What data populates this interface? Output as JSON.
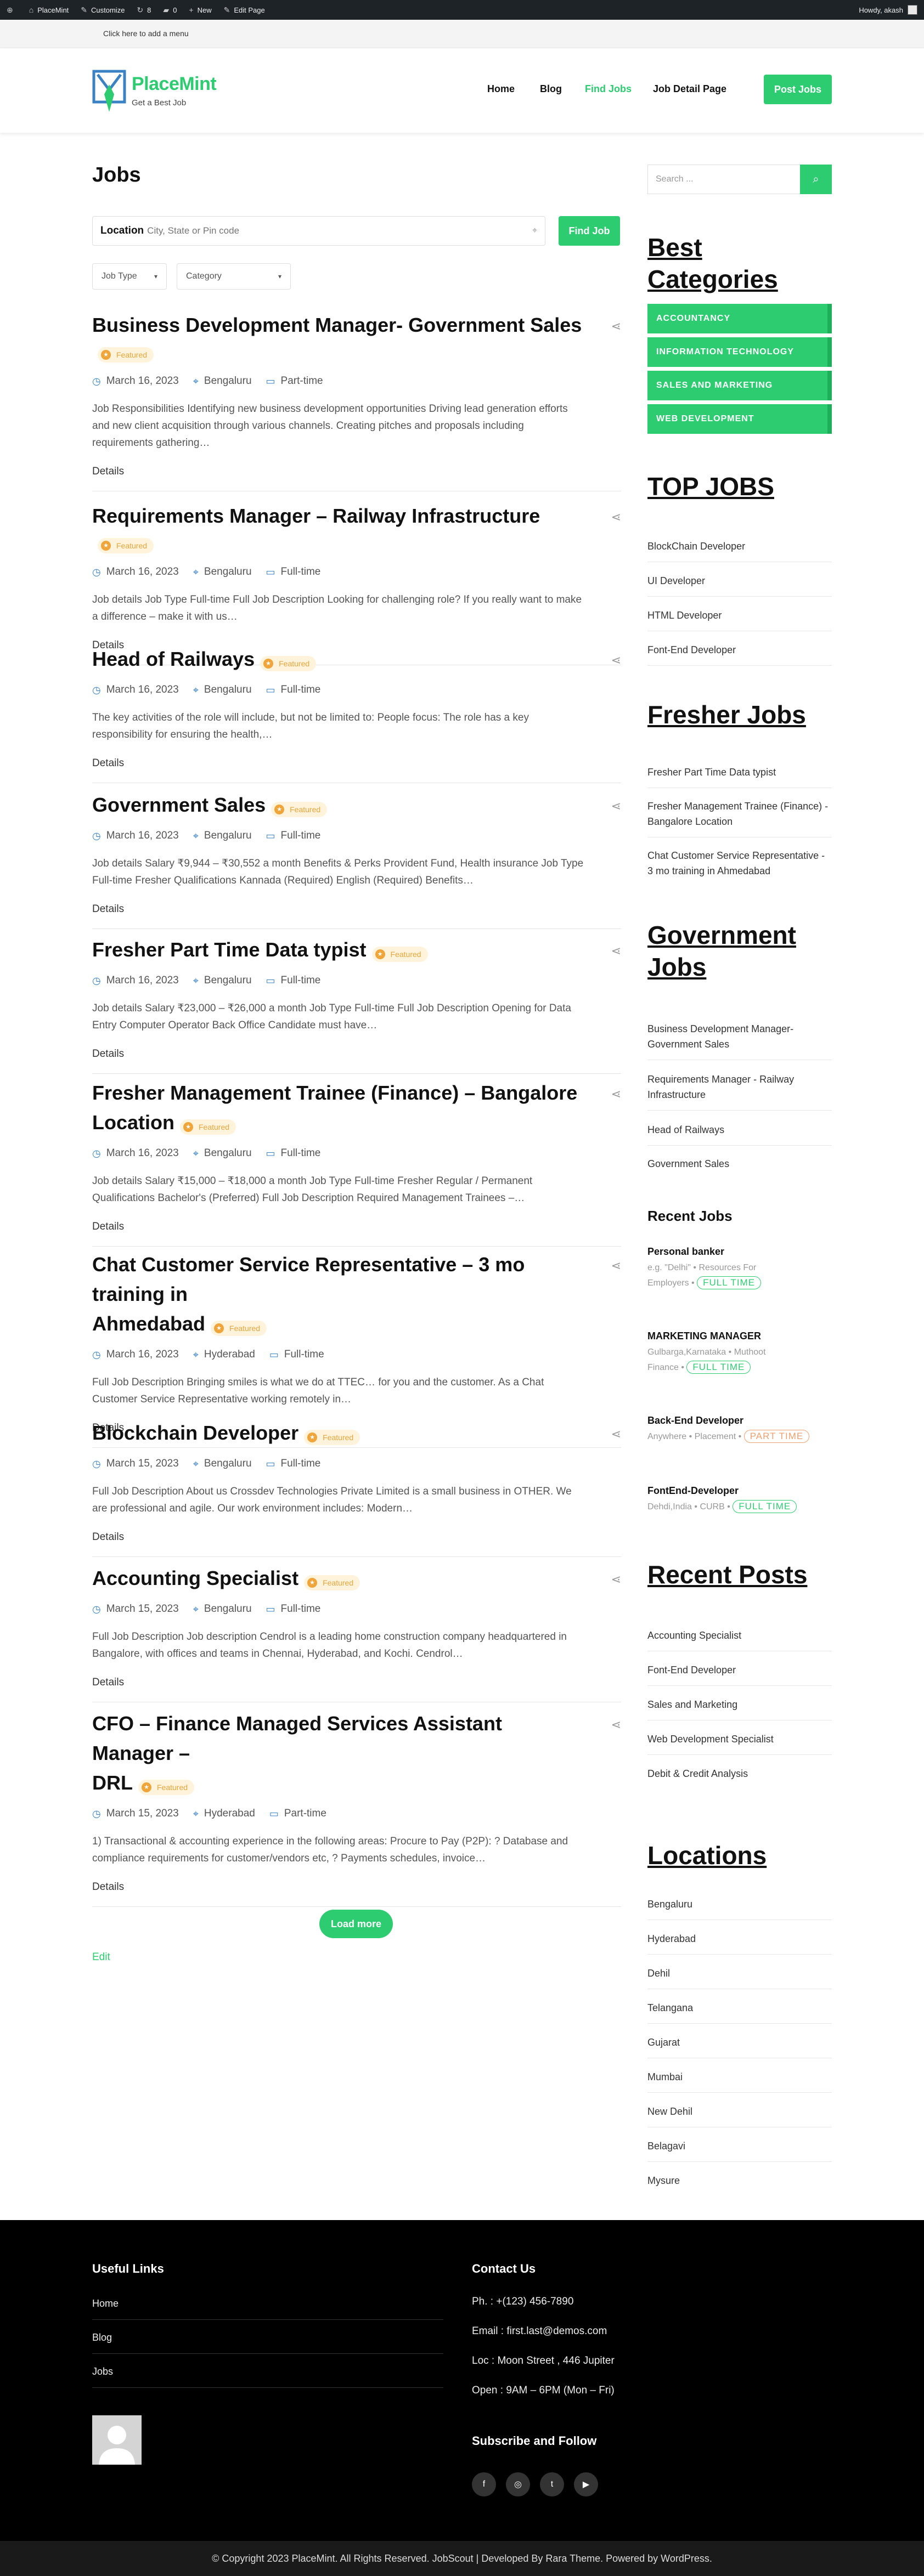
{
  "admin_bar": {
    "site_name": "PlaceMint",
    "customize": "Customize",
    "updates": "8",
    "comments": "0",
    "new": "New",
    "edit_page": "Edit Page",
    "howdy": "Howdy, akash"
  },
  "menu_hint": "Click here to add a menu",
  "site": {
    "title": "PlaceMint",
    "tagline": "Get a Best Job"
  },
  "nav": {
    "items": [
      "Home",
      "Blog",
      "Find Jobs",
      "Job Detail Page"
    ],
    "active": "Find Jobs",
    "post_button": "Post Jobs"
  },
  "page_title": "Jobs",
  "filters": {
    "location_label": "Location",
    "location_placeholder": "City, State or Pin code",
    "find_button": "Find Job",
    "job_type": "Job Type",
    "category": "Category"
  },
  "jobs": [
    {
      "title": "Business Development Manager- Government Sales",
      "badge": "Featured",
      "date": "March 16, 2023",
      "location": "Bengaluru",
      "type": "Part-time",
      "desc_lines": [
        "Job Responsibilities Identifying new business development opportunities Driving lead generation efforts",
        "and new client acquisition through various channels. Creating pitches and proposals including",
        "requirements gathering…"
      ],
      "details": "Details"
    },
    {
      "title": "Requirements Manager – Railway Infrastructure",
      "badge": "Featured",
      "date": "March 16, 2023",
      "location": "Bengaluru",
      "type": "Full-time",
      "desc_lines": [
        "Job details Job Type Full-time Full Job Description Looking for challenging role? If you really want to make",
        "a difference – make it with us…"
      ],
      "details": "Details"
    },
    {
      "title": "Head of Railways",
      "badge": "Featured",
      "date": "March 16, 2023",
      "location": "Bengaluru",
      "type": "Full-time",
      "desc_lines": [
        "The key activities of the role will include, but not be limited to: People focus: The role has a key",
        "responsibility for ensuring the health,…"
      ],
      "details": "Details"
    },
    {
      "title": "Government Sales",
      "badge": "Featured",
      "date": "March 16, 2023",
      "location": "Bengaluru",
      "type": "Full-time",
      "desc_lines": [
        "Job details Salary ₹9,944 – ₹30,552 a month Benefits & Perks Provident Fund, Health insurance Job Type",
        "Full-time Fresher Qualifications Kannada (Required) English (Required) Benefits…"
      ],
      "details": "Details"
    },
    {
      "title": "Fresher Part Time Data typist",
      "badge": "Featured",
      "date": "March 16, 2023",
      "location": "Bengaluru",
      "type": "Full-time",
      "desc_lines": [
        "Job details Salary ₹23,000 – ₹26,000 a month Job Type Full-time Full Job Description Opening for Data",
        "Entry Computer Operator Back Office Candidate must have…"
      ],
      "details": "Details"
    },
    {
      "title_lines": [
        "Fresher Management Trainee (Finance) – Bangalore",
        "Location"
      ],
      "badge": "Featured",
      "date": "March 16, 2023",
      "location": "Bengaluru",
      "type": "Full-time",
      "desc_lines": [
        "Job details Salary ₹15,000 – ₹18,000 a month Job Type Full-time Fresher Regular / Permanent",
        "Qualifications Bachelor's (Preferred) Full Job Description Required Management Trainees –…"
      ],
      "details": "Details"
    },
    {
      "title_lines": [
        "Chat Customer Service Representative – 3 mo training in",
        "Ahmedabad"
      ],
      "badge": "Featured",
      "date": "March 16, 2023",
      "location": "Hyderabad",
      "type": "Full-time",
      "desc_lines": [
        "Full Job Description Bringing smiles is what we do at TTEC… for you and the customer. As a Chat",
        "Customer Service Representative working remotely in…"
      ],
      "details": "Details"
    },
    {
      "title": "Blockchain Developer",
      "badge": "Featured",
      "date": "March 15, 2023",
      "location": "Bengaluru",
      "type": "Full-time",
      "desc_lines": [
        "Full Job Description About us Crossdev Technologies Private Limited is a small business in OTHER. We",
        "are professional and agile. Our work environment includes: Modern…"
      ],
      "details": "Details"
    },
    {
      "title": "Accounting Specialist",
      "badge": "Featured",
      "date": "March 15, 2023",
      "location": "Bengaluru",
      "type": "Full-time",
      "desc_lines": [
        "Full Job Description Job description Cendrol is a leading home construction company headquartered in",
        "Bangalore, with offices and teams in Chennai, Hyderabad, and Kochi. Cendrol…"
      ],
      "details": "Details"
    },
    {
      "title_lines": [
        "CFO – Finance Managed Services Assistant Manager –",
        "DRL"
      ],
      "badge": "Featured",
      "date": "March 15, 2023",
      "location": "Hyderabad",
      "type": "Part-time",
      "desc_lines": [
        "1) Transactional & accounting experience in the following areas: Procure to Pay (P2P): ? Database and",
        "compliance requirements for customer/vendors etc, ? Payments schedules, invoice…"
      ],
      "details": "Details"
    }
  ],
  "load_more": "Load more",
  "edit_link": "Edit",
  "sidebar": {
    "search_placeholder": "Search ...",
    "best_categories": {
      "title": "Best Categories",
      "items": [
        "ACCOUNTANCY",
        "INFORMATION TECHNOLOGY",
        "SALES AND MARKETING",
        "WEB DEVELOPMENT"
      ]
    },
    "top_jobs": {
      "title": "TOP JOBS",
      "items": [
        "BlockChain Developer",
        "UI Developer",
        "HTML Developer",
        "Font-End Developer"
      ]
    },
    "fresher_jobs": {
      "title": "Fresher Jobs",
      "items": [
        [
          "Fresher Part Time Data typist"
        ],
        [
          "Fresher Management Trainee (Finance) -",
          "Bangalore Location"
        ],
        [
          "Chat Customer Service Representative -",
          "3 mo training in Ahmedabad"
        ]
      ]
    },
    "government_jobs": {
      "title_lines": [
        "Government",
        "Jobs"
      ],
      "items": [
        [
          "Business Development Manager-",
          "Government Sales"
        ],
        [
          "Requirements Manager - Railway",
          "Infrastructure"
        ],
        [
          "Head of Railways"
        ],
        [
          "Government Sales"
        ]
      ]
    },
    "recent_jobs": {
      "title": "Recent Jobs",
      "items": [
        {
          "title": "Personal banker",
          "line1": "e.g. \"Delhi\"  •    Resources For",
          "line2": "Employers  •",
          "pill": "FULL TIME",
          "pill_color": "#2ecc71"
        },
        {
          "title": "MARKETING MANAGER",
          "line1": "Gulbarga,Karnataka  •    Muthoot",
          "line2": "Finance  •",
          "pill": "FULL TIME",
          "pill_color": "#2ecc71"
        },
        {
          "title": "Back-End Developer",
          "line1": "Anywhere  •    Placement  •",
          "line2": "",
          "pill": "PART TIME",
          "pill_color": "#f0a070"
        },
        {
          "title": "FontEnd-Developer",
          "line1": "Dehdi,India  •    CURB  •",
          "line2": "",
          "pill": "FULL TIME",
          "pill_color": "#2ecc71"
        }
      ]
    },
    "recent_posts": {
      "title": "Recent Posts",
      "items": [
        "Accounting Specialist",
        "Font-End Developer",
        "Sales and Marketing",
        "Web Development Specialist",
        "Debit & Credit Analysis"
      ]
    },
    "locations": {
      "title": "Locations",
      "items": [
        "Bengaluru",
        "Hyderabad",
        "Dehil",
        "Telangana",
        "Gujarat",
        "Mumbai",
        "New Dehil",
        "Belagavi",
        "Mysure"
      ]
    }
  },
  "footer": {
    "useful_links_title": "Useful Links",
    "useful_links": [
      "Home",
      "Blog",
      "Jobs"
    ],
    "contact_title": "Contact Us",
    "phone": "Ph. : +(123) 456-7890",
    "email": "Email : first.last@demos.com",
    "loc": "Loc : Moon Street , 446 Jupiter",
    "open": "Open : 9AM – 6PM (Mon – Fri)",
    "subscribe_title": "Subscribe and Follow",
    "social_icons": [
      "facebook-icon",
      "instagram-icon",
      "twitter-icon",
      "youtube-icon"
    ]
  },
  "copyright": "© Copyright 2023 PlaceMint. All Rights Reserved. JobScout | Developed By Rara Theme. Powered by WordPress."
}
